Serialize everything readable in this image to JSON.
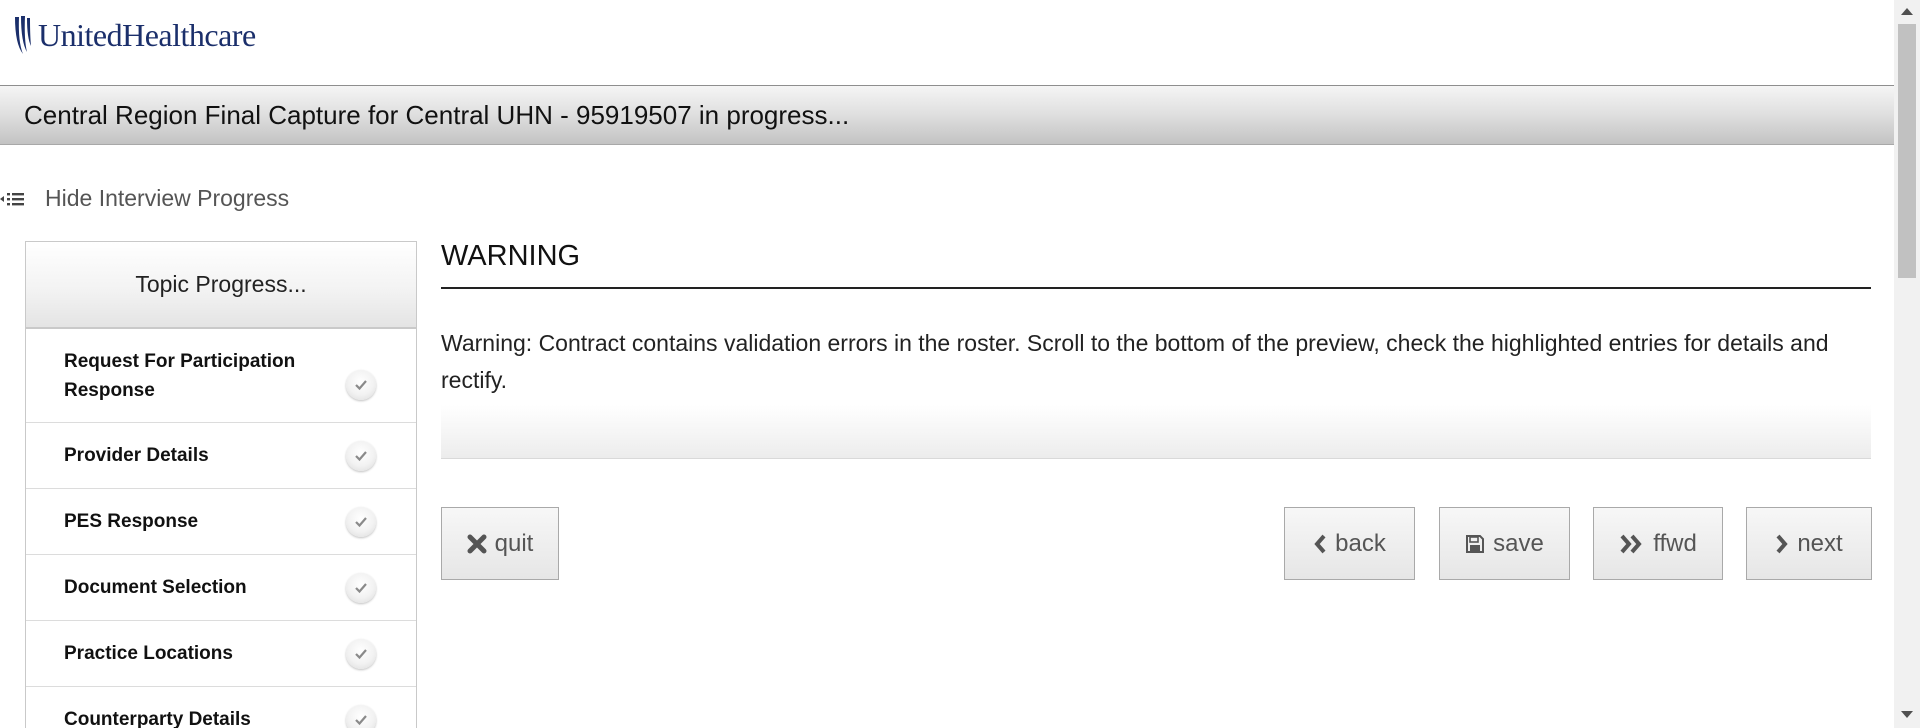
{
  "brand": {
    "name": "UnitedHealthcare",
    "color": "#1b2f6b"
  },
  "title_bar": {
    "title": "Central Region Final Capture for Central UHN - 95919507 in progress..."
  },
  "progress_toggle": {
    "label": "Hide Interview Progress",
    "icon": "collapse-list-icon"
  },
  "topic_progress": {
    "header": "Topic Progress...",
    "items": [
      {
        "label": "Request For Participation Response",
        "status": "complete"
      },
      {
        "label": "Provider Details",
        "status": "complete"
      },
      {
        "label": "PES Response",
        "status": "complete"
      },
      {
        "label": "Document Selection",
        "status": "complete"
      },
      {
        "label": "Practice Locations",
        "status": "complete"
      },
      {
        "label": "Counterparty Details",
        "status": "complete"
      }
    ]
  },
  "main": {
    "heading": "WARNING",
    "message": "Warning: Contract contains validation errors in the roster. Scroll to the bottom of the preview, check the highlighted entries for details and rectify."
  },
  "buttons": {
    "quit": {
      "label": "quit",
      "icon": "close-icon"
    },
    "back": {
      "label": "back",
      "icon": "chevron-left-icon"
    },
    "save": {
      "label": "save",
      "icon": "floppy-disk-icon"
    },
    "ffwd": {
      "label": "ffwd",
      "icon": "double-chevron-right-icon"
    },
    "next": {
      "label": "next",
      "icon": "chevron-right-icon"
    }
  }
}
